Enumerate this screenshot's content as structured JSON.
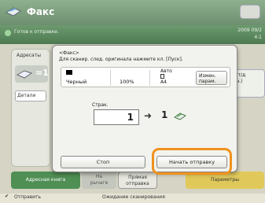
{
  "topbar": {
    "title": "Факс"
  },
  "status": {
    "text": "Готов к отправке.",
    "date": "2009 09/2",
    "time": "4:1"
  },
  "background": {
    "left_panel": {
      "addressees_label": "Адресаты",
      "equals": "=1",
      "details_label": "Детали"
    },
    "right_panel": {
      "text1": "00 т/д",
      "text2": "льн.)"
    },
    "tabs": {
      "address_book": "Адресная книга",
      "lever_top": "На",
      "lever_bottom": "рычаге",
      "direct_top": "Прямая",
      "direct_bottom": "отправка",
      "params": "Параметры"
    },
    "bottom": {
      "send_label": "Отправить",
      "scan_wait": "Ожидание сканирования"
    }
  },
  "dialog": {
    "header_line1": "<Факс>",
    "header_line2": "Для сканир. след. оригинала нажмите кл. [Пуск].",
    "color_label": "Черный",
    "ratio": "100%",
    "auto_label": "Авто",
    "paper_size": "A4",
    "change_params_line1": "Измен.",
    "change_params_line2": "парам.",
    "pages_label": "Страк.",
    "pages_in": "1",
    "pages_out": "1",
    "stop_label": "Стоп",
    "start_label": "Начать отправку"
  },
  "colors": {
    "accent_highlight": "#f0921e",
    "topbar": "#7fa07f",
    "status_green": "#5c8a60"
  }
}
